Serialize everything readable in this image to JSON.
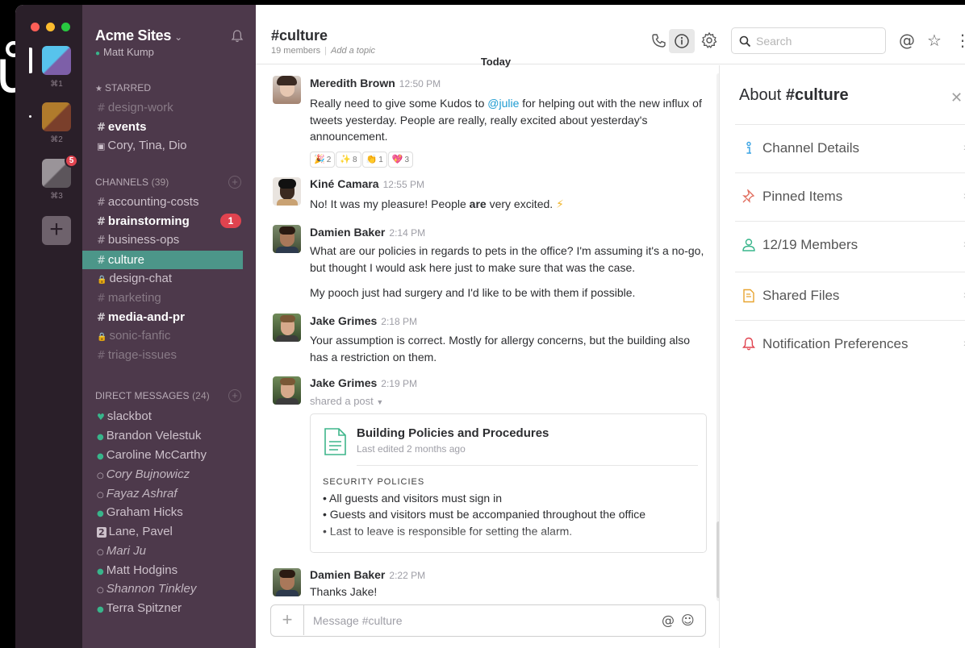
{
  "background_glyph": "ů",
  "teams": {
    "keys": [
      "⌘1",
      "⌘2",
      "⌘3"
    ],
    "badge": "5",
    "add": "+"
  },
  "sidebar": {
    "team_name": "Acme Sites",
    "user": "Matt Kump",
    "starred_header": "STARRED",
    "starred": [
      {
        "label": "design-work",
        "prefix": "#"
      },
      {
        "label": "events",
        "prefix": "#"
      },
      {
        "label": "Cory, Tina, Dio",
        "prefix": "▣"
      }
    ],
    "channels_header": "CHANNELS",
    "channels_count": "(39)",
    "channels": [
      {
        "label": "accounting-costs",
        "prefix": "#"
      },
      {
        "label": "brainstorming",
        "prefix": "#",
        "badge": "1"
      },
      {
        "label": "business-ops",
        "prefix": "#"
      },
      {
        "label": "culture",
        "prefix": "#"
      },
      {
        "label": "design-chat",
        "prefix": "🔒"
      },
      {
        "label": "marketing",
        "prefix": "#"
      },
      {
        "label": "media-and-pr",
        "prefix": "#"
      },
      {
        "label": "sonic-fanfic",
        "prefix": "🔒"
      },
      {
        "label": "triage-issues",
        "prefix": "#"
      }
    ],
    "dm_header": "DIRECT MESSAGES",
    "dm_count": "(24)",
    "dms": [
      {
        "label": "slackbot",
        "prefix": "♥"
      },
      {
        "label": "Brandon Velestuk",
        "prefix": "●"
      },
      {
        "label": "Caroline McCarthy",
        "prefix": "●"
      },
      {
        "label": "Cory Bujnowicz",
        "prefix": "○"
      },
      {
        "label": "Fayaz Ashraf",
        "prefix": "○"
      },
      {
        "label": "Graham Hicks",
        "prefix": "●"
      },
      {
        "label": "Lane, Pavel",
        "prefix": "2"
      },
      {
        "label": "Mari Ju",
        "prefix": "○"
      },
      {
        "label": "Matt Hodgins",
        "prefix": "●"
      },
      {
        "label": "Shannon Tinkley",
        "prefix": "○"
      },
      {
        "label": "Terra Spitzner",
        "prefix": "●"
      }
    ]
  },
  "header": {
    "channel": "#culture",
    "members": "19 members",
    "topic": "Add a topic",
    "search_placeholder": "Search"
  },
  "day_divider": "Today",
  "messages": [
    {
      "author": "Meredith Brown",
      "time": "12:50 PM",
      "pre": "Really need to give some Kudos to ",
      "mention": "@julie",
      "post": " for helping out with the new influx of tweets yesterday. People are really, really excited about yesterday's announcement.",
      "reactions": [
        {
          "emoji": "🎉",
          "count": "2"
        },
        {
          "emoji": "✨",
          "count": "8"
        },
        {
          "emoji": "👏",
          "count": "1"
        },
        {
          "emoji": "💖",
          "count": "3"
        }
      ]
    },
    {
      "author": "Kiné Camara",
      "time": "12:55 PM",
      "pre": "No! It was my pleasure! People ",
      "bold": "are",
      "post": " very excited.",
      "emoji": "⚡"
    },
    {
      "author": "Damien Baker",
      "time": "2:14 PM",
      "text": "What are our policies in regards to pets in the office? I'm assuming it's a no-go, but thought I would ask here just to make sure that was the case.",
      "text2": "My pooch just had surgery and I'd like to be with them if possible."
    },
    {
      "author": "Jake Grimes",
      "time": "2:18 PM",
      "text": "Your assumption is correct. Mostly for allergy concerns, but the building also has a restriction on them."
    },
    {
      "author": "Jake Grimes",
      "time": "2:19 PM",
      "shared": "shared a post",
      "post": {
        "title": "Building Policies and Procedures",
        "subtitle": "Last edited 2 months ago",
        "section": "SECURITY POLICIES",
        "bullets": [
          "• All guests and visitors must sign in",
          "• Guests and visitors must be accompanied throughout the office",
          "• Last to leave is responsible for setting the alarm."
        ]
      }
    },
    {
      "author": "Damien Baker",
      "time": "2:22 PM",
      "text": "Thanks Jake!"
    }
  ],
  "composer": {
    "placeholder": "Message #culture"
  },
  "pane": {
    "title_prefix": "About ",
    "title_channel": "#culture",
    "rows": [
      {
        "label": "Channel Details",
        "icon": "info-icon",
        "color": "#3aa3e3"
      },
      {
        "label": "Pinned Items",
        "icon": "pin-icon",
        "color": "#e06b5b"
      },
      {
        "label": "12/19 Members",
        "icon": "person-icon",
        "color": "#38b58b"
      },
      {
        "label": "Shared Files",
        "icon": "file-icon",
        "color": "#e8a430"
      },
      {
        "label": "Notification Preferences",
        "icon": "bell-icon",
        "color": "#e0434f"
      }
    ]
  },
  "colors": {
    "sidebar": "#4d394b",
    "teams": "#2a1f29",
    "active_channel": "#4c9689",
    "badge": "#e0434f",
    "presence": "#38b58b",
    "mention": "#1d9bd1"
  }
}
